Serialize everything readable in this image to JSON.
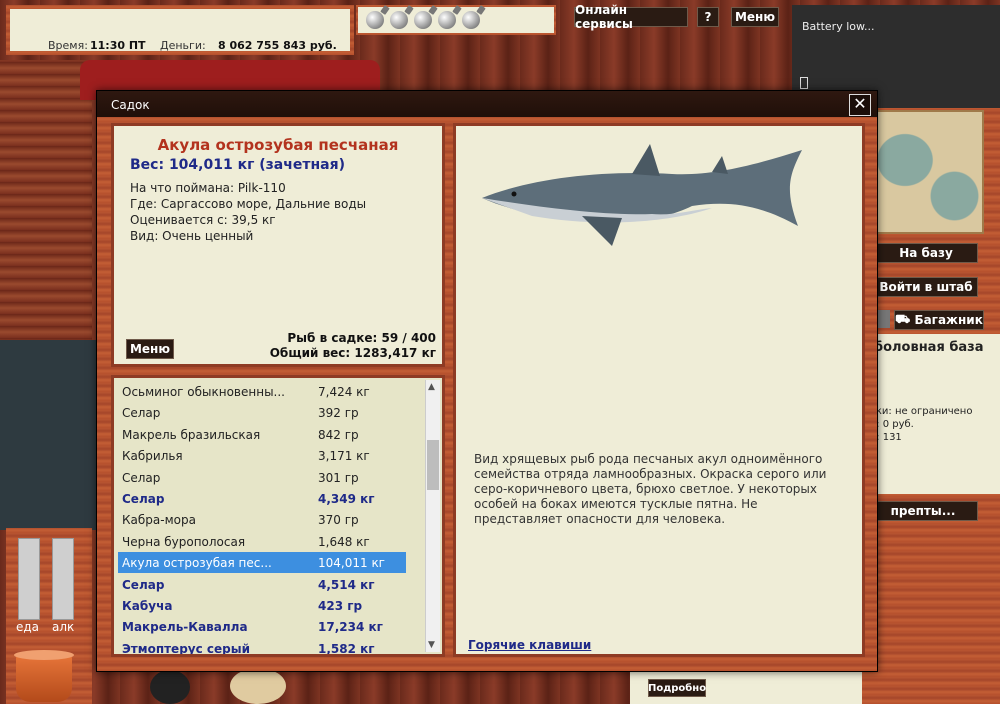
{
  "hud": {
    "time_label": "Время:",
    "time_value": "11:30 ПТ",
    "money_label": "Деньги:",
    "money_value": "8 062 755 843 руб."
  },
  "top_buttons": {
    "online": "Онлайн сервисы",
    "help": "?",
    "menu": "Меню"
  },
  "battery": {
    "text": "Battery low..."
  },
  "right_side": {
    "to_base": "На базу",
    "enter_hq": "Войти в штаб",
    "trunk": "Багажник",
    "base_title": "боловная база",
    "line1": "вки: не ограничено",
    "line2": "е: 0 руб.",
    "line3": "е: 131",
    "recipes": "препты...",
    "details": "Подробно"
  },
  "gauges": {
    "food": "еда",
    "alc": "алк"
  },
  "dialog": {
    "title": "Садок",
    "close": "✕",
    "fish": {
      "name": "Акула острозубая песчаная",
      "weight": "Вес: 104,011 кг (зачетная)",
      "caught_with": "На что поймана: Pilk-110",
      "where": "Где: Саргассово море, Дальние воды",
      "valued_from": "Оценивается с: 39,5 кг",
      "kind": "Вид: Очень ценный"
    },
    "menu_button": "Меню",
    "count": "Рыб в садке: 59 / 400",
    "total_weight": "Общий вес: 1283,417 кг",
    "description": "Вид хрящевых рыб рода песчаных акул одноимённого семейства отряда ламнообразных. Окраска серого или серо-коричневого цвета, брюхо светлое. У некоторых особей на боках имеются тусклые пятна. Не представляет опасности для человека.",
    "hotkeys": "Горячие клавиши",
    "list": [
      {
        "name": "Осьминог обыкновенны...",
        "weight": "7,424 кг",
        "style": "normal"
      },
      {
        "name": "Селар",
        "weight": "392 гр",
        "style": "normal"
      },
      {
        "name": "Макрель бразильская",
        "weight": "842 гр",
        "style": "normal"
      },
      {
        "name": "Кабрилья",
        "weight": "3,171 кг",
        "style": "normal"
      },
      {
        "name": "Селар",
        "weight": "301 гр",
        "style": "normal"
      },
      {
        "name": "Селар",
        "weight": "4,349 кг",
        "style": "bold"
      },
      {
        "name": "Кабра-мора",
        "weight": "370 гр",
        "style": "normal"
      },
      {
        "name": "Черна бурополосая",
        "weight": "1,648 кг",
        "style": "normal"
      },
      {
        "name": "Акула острозубая пес...",
        "weight": "104,011 кг",
        "style": "selected"
      },
      {
        "name": "Селар",
        "weight": "4,514 кг",
        "style": "bold"
      },
      {
        "name": "Кабуча",
        "weight": "423 гр",
        "style": "bold"
      },
      {
        "name": "Макрель-Кавалла",
        "weight": "17,234 кг",
        "style": "bold"
      },
      {
        "name": "Этмоптерус серый",
        "weight": "1,582 кг",
        "style": "bold"
      }
    ]
  }
}
